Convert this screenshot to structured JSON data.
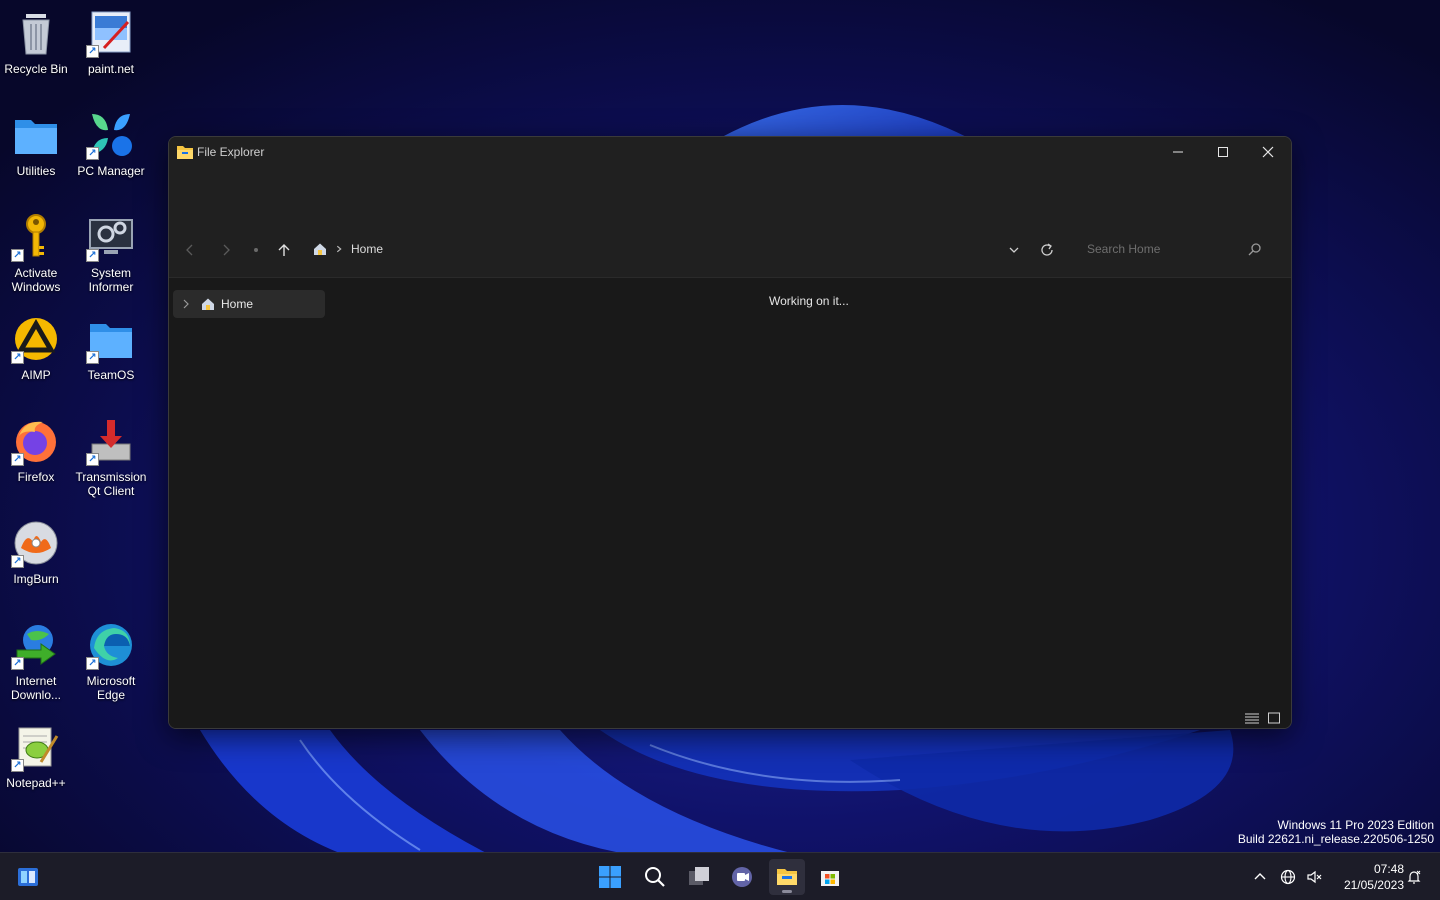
{
  "desktop": {
    "icons": [
      {
        "label": "Recycle Bin",
        "icon": "recycle-bin-icon",
        "shortcut": false
      },
      {
        "label": "paint.net",
        "icon": "paintnet-icon",
        "shortcut": true
      },
      {
        "label": "Utilities",
        "icon": "folder-icon",
        "shortcut": false
      },
      {
        "label": "PC Manager",
        "icon": "pc-manager-icon",
        "shortcut": true
      },
      {
        "label": "Activate Windows",
        "icon": "key-icon",
        "shortcut": true
      },
      {
        "label": "System Informer",
        "icon": "system-informer-icon",
        "shortcut": true
      },
      {
        "label": "AIMP",
        "icon": "aimp-icon",
        "shortcut": true
      },
      {
        "label": "TeamOS",
        "icon": "folder-icon",
        "shortcut": true
      },
      {
        "label": "Firefox",
        "icon": "firefox-icon",
        "shortcut": true
      },
      {
        "label": "Transmission Qt Client",
        "icon": "transmission-icon",
        "shortcut": true
      },
      {
        "label": "ImgBurn",
        "icon": "imgburn-icon",
        "shortcut": true
      },
      {
        "label": "Internet Downlo...",
        "icon": "internet-download-manager-icon",
        "shortcut": true
      },
      {
        "label": "Microsoft Edge",
        "icon": "edge-icon",
        "shortcut": true
      },
      {
        "label": "Notepad++",
        "icon": "notepadpp-icon",
        "shortcut": true
      }
    ]
  },
  "explorer": {
    "title": "File Explorer",
    "breadcrumb": "Home",
    "search_placeholder": "Search Home",
    "nav_pane_item": "Home",
    "status": "Working on it..."
  },
  "watermark": {
    "line1": "Windows 11 Pro 2023 Edition",
    "line2": "Build 22621.ni_release.220506-1250"
  },
  "taskbar": {
    "time": "07:48",
    "date": "21/05/2023"
  },
  "colors": {
    "accent": "#0078d4",
    "folder_yellow": "#f5c542",
    "window_bg": "#191919",
    "titlebar_bg": "#202020"
  }
}
